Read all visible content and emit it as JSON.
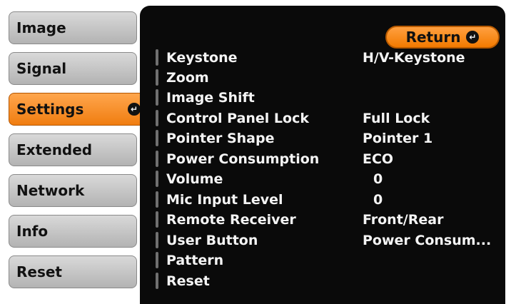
{
  "tabs": [
    {
      "label": "Image"
    },
    {
      "label": "Signal"
    },
    {
      "label": "Settings"
    },
    {
      "label": "Extended"
    },
    {
      "label": "Network"
    },
    {
      "label": "Info"
    },
    {
      "label": "Reset"
    }
  ],
  "active_tab": "Settings",
  "return_button": {
    "label": "Return"
  },
  "menu": [
    {
      "label": "Keystone",
      "value": "H/V-Keystone"
    },
    {
      "label": "Zoom",
      "value": ""
    },
    {
      "label": "Image Shift",
      "value": ""
    },
    {
      "label": "Control Panel Lock",
      "value": "Full Lock"
    },
    {
      "label": "Pointer Shape",
      "value": "Pointer 1"
    },
    {
      "label": "Power Consumption",
      "value": "ECO"
    },
    {
      "label": "Volume",
      "value": "0"
    },
    {
      "label": "Mic Input Level",
      "value": "0"
    },
    {
      "label": "Remote Receiver",
      "value": "Front/Rear"
    },
    {
      "label": "User Button",
      "value": "Power Consum..."
    },
    {
      "label": "Pattern",
      "value": ""
    },
    {
      "label": "Reset",
      "value": ""
    }
  ],
  "icons": {
    "enter": "enter-icon"
  }
}
